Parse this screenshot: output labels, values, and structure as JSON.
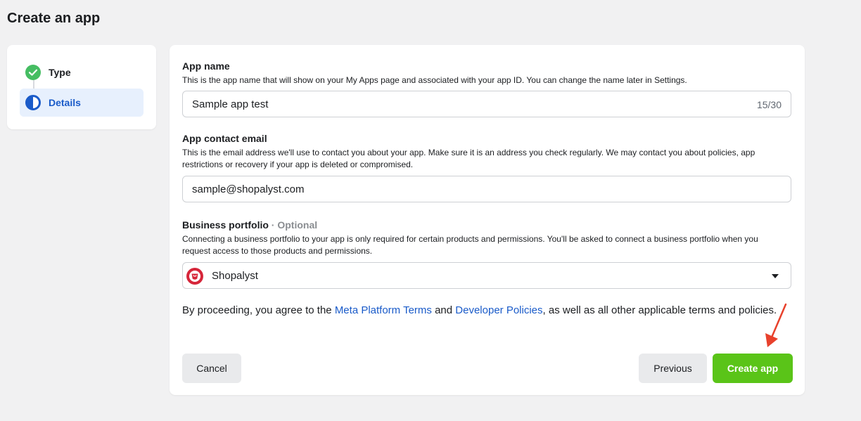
{
  "page": {
    "title": "Create an app"
  },
  "steps": [
    {
      "label": "Type",
      "status": "complete",
      "icon": "check-circle-icon"
    },
    {
      "label": "Details",
      "status": "current",
      "icon": "half-circle-icon"
    }
  ],
  "form": {
    "app_name": {
      "label": "App name",
      "description": "This is the app name that will show on your My Apps page and associated with your app ID. You can change the name later in Settings.",
      "value": "Sample app test",
      "counter": "15/30"
    },
    "contact_email": {
      "label": "App contact email",
      "description": "This is the email address we'll use to contact you about your app. Make sure it is an address you check regularly. We may contact you about policies, app restrictions or recovery if your app is deleted or compromised.",
      "value": "sample@shopalyst.com"
    },
    "business_portfolio": {
      "label": "Business portfolio",
      "optional": "· Optional",
      "description": "Connecting a business portfolio to your app is only required for certain products and permissions. You'll be asked to connect a business portfolio when you request access to those products and permissions.",
      "selected": "Shopalyst"
    },
    "terms": {
      "prefix": "By proceeding, you agree to the ",
      "link1": "Meta Platform Terms",
      "middle": " and ",
      "link2": "Developer Policies",
      "suffix": ", as well as all other applicable terms and policies."
    }
  },
  "buttons": {
    "cancel": "Cancel",
    "previous": "Previous",
    "create": "Create app"
  },
  "colors": {
    "accent_green": "#5ac418",
    "link_blue": "#1a5bc9",
    "active_step_bg": "#e7f0fd",
    "annotation_arrow": "#e8412c"
  }
}
